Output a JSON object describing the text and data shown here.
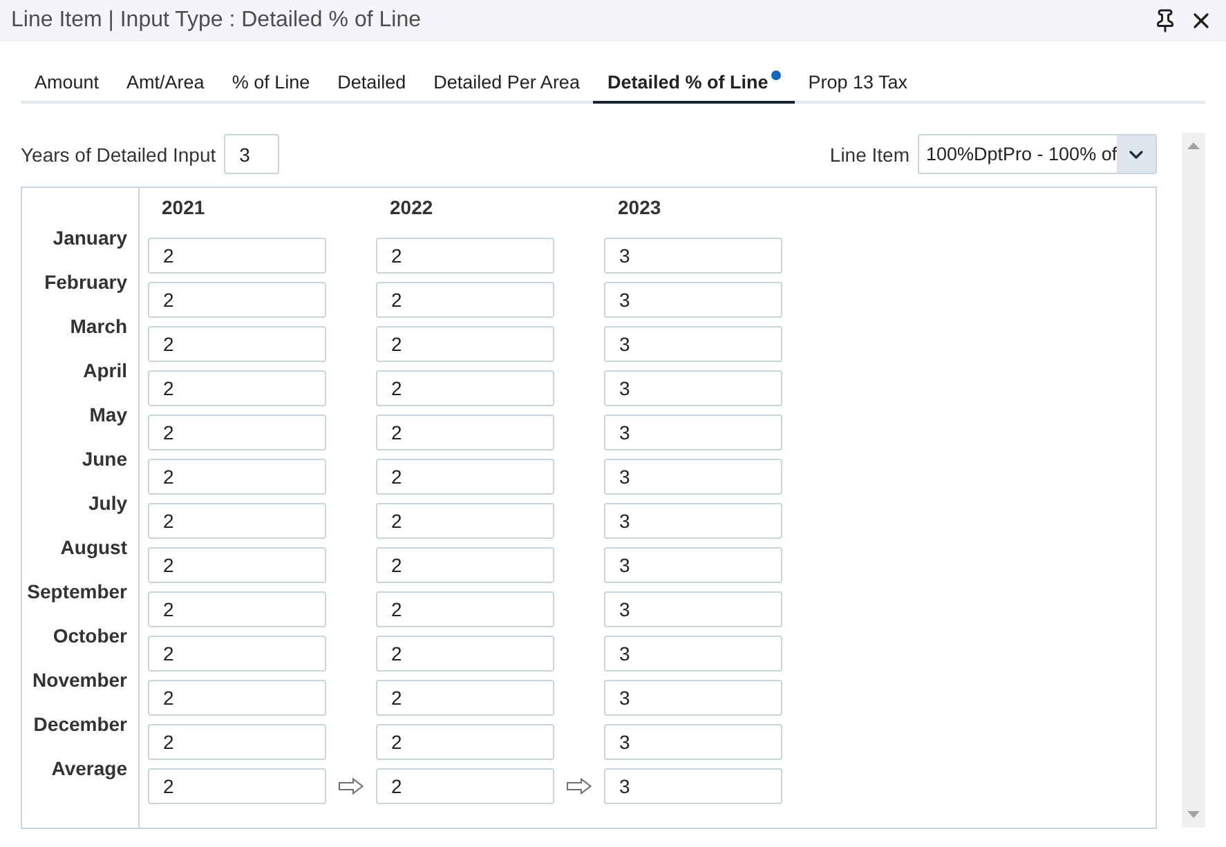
{
  "window": {
    "title": "Line Item | Input Type : Detailed % of Line"
  },
  "tabs": [
    {
      "label": "Amount",
      "selected": false,
      "modified": false
    },
    {
      "label": "Amt/Area",
      "selected": false,
      "modified": false
    },
    {
      "label": "% of Line",
      "selected": false,
      "modified": false
    },
    {
      "label": "Detailed",
      "selected": false,
      "modified": false
    },
    {
      "label": "Detailed Per Area",
      "selected": false,
      "modified": false
    },
    {
      "label": "Detailed % of Line",
      "selected": true,
      "modified": true
    },
    {
      "label": "Prop 13 Tax",
      "selected": false,
      "modified": false
    }
  ],
  "years_input": {
    "label": "Years of Detailed Input",
    "value": "3"
  },
  "line_item": {
    "label": "Line Item",
    "value": "100%DptPro - 100% of"
  },
  "grid": {
    "years": [
      "2021",
      "2022",
      "2023"
    ],
    "rows": [
      {
        "kind": "month",
        "label": "January",
        "values": [
          "2",
          "2",
          "3"
        ]
      },
      {
        "kind": "month",
        "label": "February",
        "values": [
          "2",
          "2",
          "3"
        ]
      },
      {
        "kind": "month",
        "label": "March",
        "values": [
          "2",
          "2",
          "3"
        ]
      },
      {
        "kind": "month",
        "label": "April",
        "values": [
          "2",
          "2",
          "3"
        ]
      },
      {
        "kind": "month",
        "label": "May",
        "values": [
          "2",
          "2",
          "3"
        ]
      },
      {
        "kind": "month",
        "label": "June",
        "values": [
          "2",
          "2",
          "3"
        ]
      },
      {
        "kind": "month",
        "label": "July",
        "values": [
          "2",
          "2",
          "3"
        ]
      },
      {
        "kind": "month",
        "label": "August",
        "values": [
          "2",
          "2",
          "3"
        ]
      },
      {
        "kind": "month",
        "label": "September",
        "values": [
          "2",
          "2",
          "3"
        ]
      },
      {
        "kind": "month",
        "label": "October",
        "values": [
          "2",
          "2",
          "3"
        ]
      },
      {
        "kind": "month",
        "label": "November",
        "values": [
          "2",
          "2",
          "3"
        ]
      },
      {
        "kind": "month",
        "label": "December",
        "values": [
          "2",
          "2",
          "3"
        ]
      },
      {
        "kind": "average",
        "label": "Average",
        "values": [
          "2",
          "2",
          "3"
        ]
      }
    ]
  }
}
